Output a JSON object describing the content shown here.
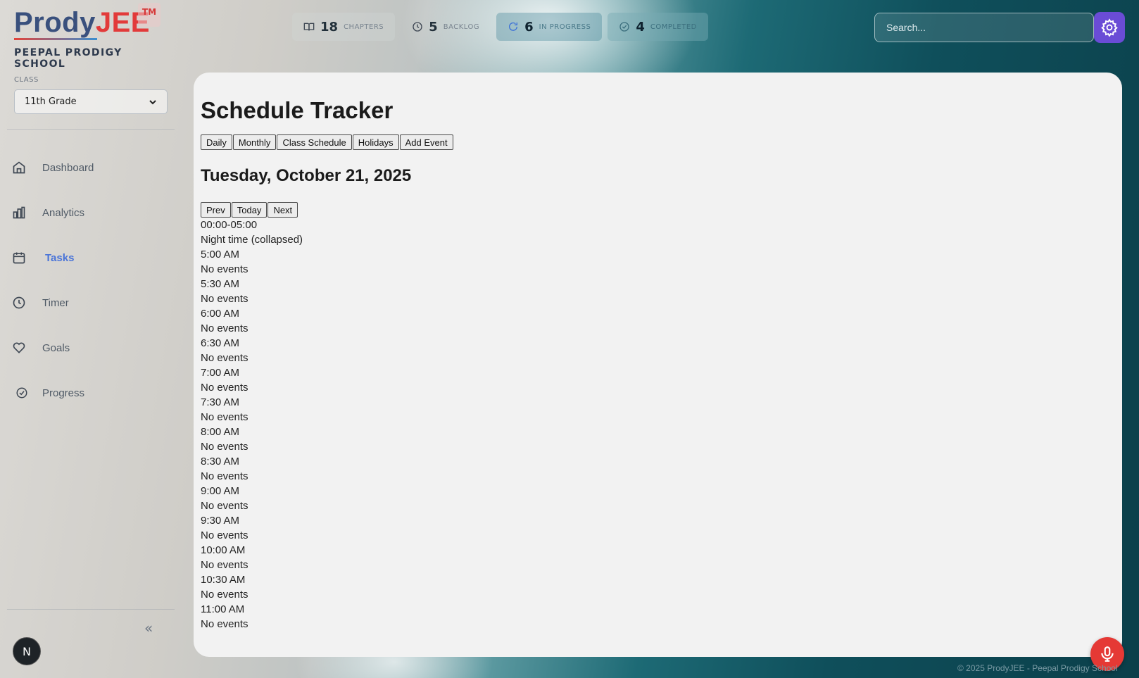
{
  "brand": {
    "part1": "Prody",
    "part2": "JEE",
    "tm": "TM",
    "school": "PEEPAL PRODIGY SCHOOL"
  },
  "class_selector": {
    "label": "CLASS",
    "value": "11th Grade"
  },
  "sidebar": {
    "items": [
      {
        "label": "Dashboard",
        "icon": "home-icon"
      },
      {
        "label": "Analytics",
        "icon": "bar-chart-icon"
      },
      {
        "label": "Tasks",
        "icon": "calendar-icon",
        "active": true
      },
      {
        "label": "Timer",
        "icon": "clock-icon"
      },
      {
        "label": "Goals",
        "icon": "heart-icon"
      },
      {
        "label": "Progress",
        "icon": "check-circle-icon"
      }
    ],
    "avatar_initial": "N"
  },
  "stats": [
    {
      "value": "18",
      "label": "CHAPTERS"
    },
    {
      "value": "5",
      "label": "BACKLOG"
    },
    {
      "value": "6",
      "label": "IN PROGRESS"
    },
    {
      "value": "4",
      "label": "COMPLETED"
    }
  ],
  "search": {
    "placeholder": "Search..."
  },
  "main": {
    "title": "Schedule Tracker",
    "tabs": [
      "Daily",
      "Monthly",
      "Class Schedule",
      "Holidays",
      "Add Event"
    ],
    "date": "Tuesday, October 21, 2025",
    "nav_buttons": [
      "Prev",
      "Today",
      "Next"
    ],
    "night_range": "00:00-05:00",
    "night_label": "Night time (collapsed)",
    "slots": [
      {
        "time": "5:00 AM",
        "status": "No events"
      },
      {
        "time": "5:30 AM",
        "status": "No events"
      },
      {
        "time": "6:00 AM",
        "status": "No events"
      },
      {
        "time": "6:30 AM",
        "status": "No events"
      },
      {
        "time": "7:00 AM",
        "status": "No events"
      },
      {
        "time": "7:30 AM",
        "status": "No events"
      },
      {
        "time": "8:00 AM",
        "status": "No events"
      },
      {
        "time": "8:30 AM",
        "status": "No events"
      },
      {
        "time": "9:00 AM",
        "status": "No events"
      },
      {
        "time": "9:30 AM",
        "status": "No events"
      },
      {
        "time": "10:00 AM",
        "status": "No events"
      },
      {
        "time": "10:30 AM",
        "status": "No events"
      },
      {
        "time": "11:00 AM",
        "status": "No events"
      }
    ]
  },
  "footer": "© 2025 ProdyJEE - Peepal Prodigy School",
  "colors": {
    "accent": "#6a4cd6",
    "active_nav": "#4a74d8",
    "mic": "#e53935"
  }
}
